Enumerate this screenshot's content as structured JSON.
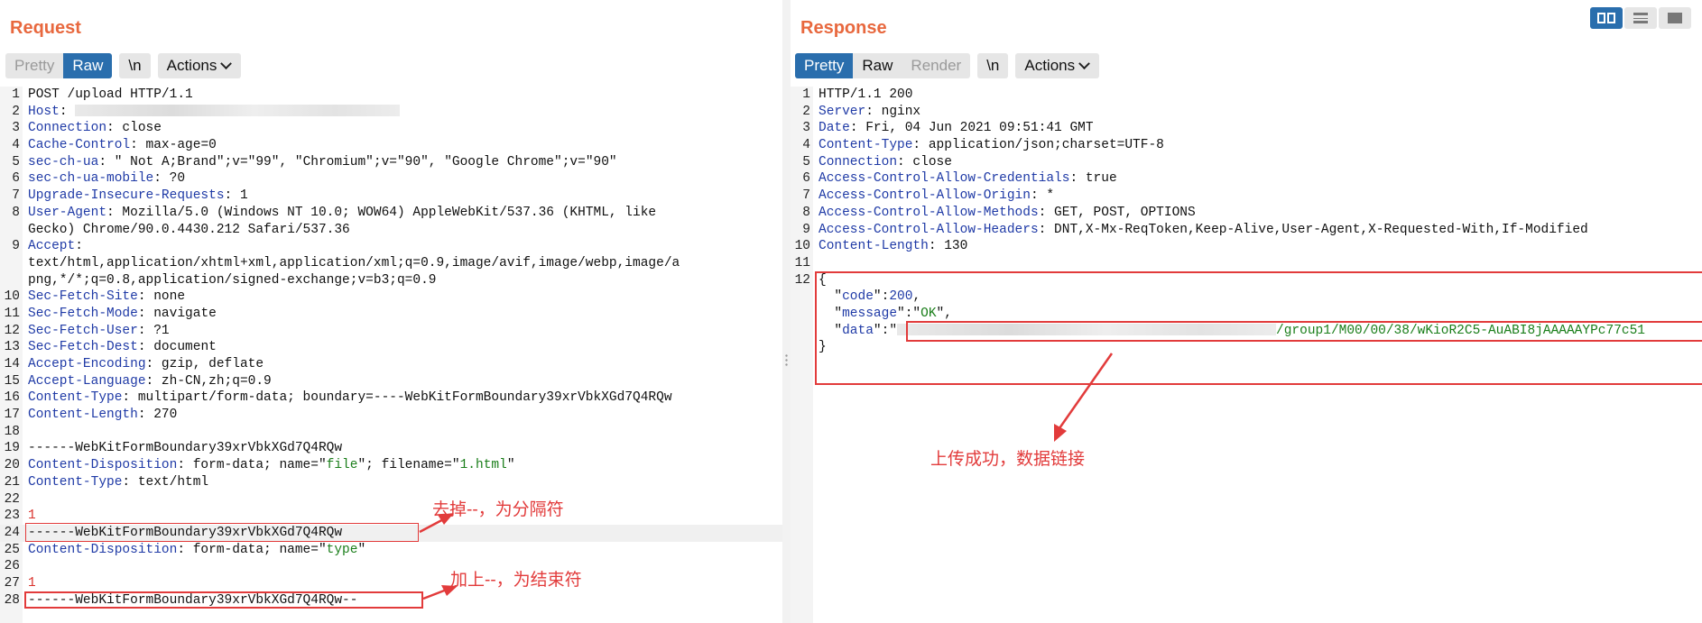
{
  "request": {
    "title": "Request",
    "buttons": {
      "pretty": "Pretty",
      "raw": "Raw",
      "newline": "\\n",
      "actions": "Actions"
    },
    "lines": [
      {
        "n": "1",
        "parts": [
          [
            "",
            "POST /upload HTTP/1.1"
          ]
        ]
      },
      {
        "n": "2",
        "parts": [
          [
            "k",
            "Host"
          ],
          [
            "",
            ": "
          ],
          [
            "redact",
            "360"
          ]
        ]
      },
      {
        "n": "3",
        "parts": [
          [
            "k",
            "Connection"
          ],
          [
            "",
            ": close"
          ]
        ]
      },
      {
        "n": "4",
        "parts": [
          [
            "k",
            "Cache-Control"
          ],
          [
            "",
            ": max-age=0"
          ]
        ]
      },
      {
        "n": "5",
        "parts": [
          [
            "k",
            "sec-ch-ua"
          ],
          [
            "",
            ": \" Not A;Brand\";v=\"99\", \"Chromium\";v=\"90\", \"Google Chrome\";v=\"90\""
          ]
        ]
      },
      {
        "n": "6",
        "parts": [
          [
            "k",
            "sec-ch-ua-mobile"
          ],
          [
            "",
            ": ?0"
          ]
        ]
      },
      {
        "n": "7",
        "parts": [
          [
            "k",
            "Upgrade-Insecure-Requests"
          ],
          [
            "",
            ": 1"
          ]
        ]
      },
      {
        "n": "8",
        "parts": [
          [
            "k",
            "User-Agent"
          ],
          [
            "",
            ": Mozilla/5.0 (Windows NT 10.0; WOW64) AppleWebKit/537.36 (KHTML, like"
          ]
        ]
      },
      {
        "n": "",
        "parts": [
          [
            "",
            "Gecko) Chrome/90.0.4430.212 Safari/537.36"
          ]
        ]
      },
      {
        "n": "9",
        "parts": [
          [
            "k",
            "Accept"
          ],
          [
            "",
            ":"
          ]
        ]
      },
      {
        "n": "",
        "parts": [
          [
            "",
            "text/html,application/xhtml+xml,application/xml;q=0.9,image/avif,image/webp,image/a"
          ]
        ]
      },
      {
        "n": "",
        "parts": [
          [
            "",
            "png,*/*;q=0.8,application/signed-exchange;v=b3;q=0.9"
          ]
        ]
      },
      {
        "n": "10",
        "parts": [
          [
            "k",
            "Sec-Fetch-Site"
          ],
          [
            "",
            ": none"
          ]
        ]
      },
      {
        "n": "11",
        "parts": [
          [
            "k",
            "Sec-Fetch-Mode"
          ],
          [
            "",
            ": navigate"
          ]
        ]
      },
      {
        "n": "12",
        "parts": [
          [
            "k",
            "Sec-Fetch-User"
          ],
          [
            "",
            ": ?1"
          ]
        ]
      },
      {
        "n": "13",
        "parts": [
          [
            "k",
            "Sec-Fetch-Dest"
          ],
          [
            "",
            ": document"
          ]
        ]
      },
      {
        "n": "14",
        "parts": [
          [
            "k",
            "Accept-Encoding"
          ],
          [
            "",
            ": gzip, deflate"
          ]
        ]
      },
      {
        "n": "15",
        "parts": [
          [
            "k",
            "Accept-Language"
          ],
          [
            "",
            ": zh-CN,zh;q=0.9"
          ]
        ]
      },
      {
        "n": "16",
        "parts": [
          [
            "k",
            "Content-Type"
          ],
          [
            "",
            ": multipart/form-data; boundary=----WebKitFormBoundary39xrVbkXGd7Q4RQw"
          ]
        ]
      },
      {
        "n": "17",
        "parts": [
          [
            "k",
            "Content-Length"
          ],
          [
            "",
            ": 270"
          ]
        ]
      },
      {
        "n": "18",
        "parts": []
      },
      {
        "n": "19",
        "parts": [
          [
            "",
            "------WebKitFormBoundary39xrVbkXGd7Q4RQw"
          ]
        ]
      },
      {
        "n": "20",
        "parts": [
          [
            "k",
            "Content-Disposition"
          ],
          [
            "",
            ": form-data; name=\""
          ],
          [
            "s",
            "file"
          ],
          [
            "",
            "\"; filename=\""
          ],
          [
            "s",
            "1.html"
          ],
          [
            "",
            "\""
          ]
        ]
      },
      {
        "n": "21",
        "parts": [
          [
            "k",
            "Content-Type"
          ],
          [
            "",
            ": text/html"
          ]
        ]
      },
      {
        "n": "22",
        "parts": []
      },
      {
        "n": "23",
        "parts": [
          [
            "red",
            "1"
          ]
        ]
      },
      {
        "n": "24",
        "parts": [
          [
            "",
            "------WebKitFormBoundary39xrVbkXGd7Q4RQw"
          ]
        ],
        "hl": true
      },
      {
        "n": "25",
        "parts": [
          [
            "k",
            "Content-Disposition"
          ],
          [
            "",
            ": form-data; name=\""
          ],
          [
            "s",
            "type"
          ],
          [
            "",
            "\""
          ]
        ]
      },
      {
        "n": "26",
        "parts": []
      },
      {
        "n": "27",
        "parts": [
          [
            "red",
            "1"
          ]
        ]
      },
      {
        "n": "28",
        "parts": [
          [
            "",
            "------WebKitFormBoundary39xrVbkXGd7Q4RQw--"
          ]
        ]
      }
    ]
  },
  "response": {
    "title": "Response",
    "buttons": {
      "pretty": "Pretty",
      "raw": "Raw",
      "render": "Render",
      "newline": "\\n",
      "actions": "Actions"
    },
    "lines": [
      {
        "n": "1",
        "parts": [
          [
            "",
            "HTTP/1.1 200"
          ]
        ]
      },
      {
        "n": "2",
        "parts": [
          [
            "k",
            "Server"
          ],
          [
            "",
            ": nginx"
          ]
        ]
      },
      {
        "n": "3",
        "parts": [
          [
            "k",
            "Date"
          ],
          [
            "",
            ": Fri, 04 Jun 2021 09:51:41 GMT"
          ]
        ]
      },
      {
        "n": "4",
        "parts": [
          [
            "k",
            "Content-Type"
          ],
          [
            "",
            ": application/json;charset=UTF-8"
          ]
        ]
      },
      {
        "n": "5",
        "parts": [
          [
            "k",
            "Connection"
          ],
          [
            "",
            ": close"
          ]
        ]
      },
      {
        "n": "6",
        "parts": [
          [
            "k",
            "Access-Control-Allow-Credentials"
          ],
          [
            "",
            ": true"
          ]
        ]
      },
      {
        "n": "7",
        "parts": [
          [
            "k",
            "Access-Control-Allow-Origin"
          ],
          [
            "",
            ": *"
          ]
        ]
      },
      {
        "n": "8",
        "parts": [
          [
            "k",
            "Access-Control-Allow-Methods"
          ],
          [
            "",
            ": GET, POST, OPTIONS"
          ]
        ]
      },
      {
        "n": "9",
        "parts": [
          [
            "k",
            "Access-Control-Allow-Headers"
          ],
          [
            "",
            ": DNT,X-Mx-ReqToken,Keep-Alive,User-Agent,X-Requested-With,If-Modified"
          ]
        ]
      },
      {
        "n": "10",
        "parts": [
          [
            "k",
            "Content-Length"
          ],
          [
            "",
            ": 130"
          ]
        ]
      },
      {
        "n": "11",
        "parts": []
      },
      {
        "n": "12",
        "parts": [
          [
            "",
            "{"
          ]
        ]
      },
      {
        "n": "",
        "parts": [
          [
            "",
            "  \""
          ],
          [
            "k",
            "code"
          ],
          [
            "",
            "\":"
          ],
          [
            "n",
            "200"
          ],
          [
            "",
            ","
          ]
        ]
      },
      {
        "n": "",
        "parts": [
          [
            "",
            "  \""
          ],
          [
            "k",
            "message"
          ],
          [
            "",
            "\":\""
          ],
          [
            "s",
            "OK"
          ],
          [
            "",
            "\","
          ]
        ]
      },
      {
        "n": "",
        "parts": [
          [
            "",
            "  \""
          ],
          [
            "k",
            "data"
          ],
          [
            "",
            "\":\""
          ],
          [
            "redact",
            "420"
          ],
          [
            "s",
            "/group1/M00/00/38/wKioR2C5-AuABI8jAAAAAYPc77c51"
          ]
        ]
      },
      {
        "n": "",
        "parts": [
          [
            "",
            "}"
          ]
        ]
      }
    ]
  },
  "annotations": {
    "remove_note": "去掉--，为分隔符",
    "add_note": "加上--，为结束符",
    "success_note": "上传成功，数据链接"
  },
  "view_toggles": [
    "split-horizontal-icon",
    "split-vertical-icon",
    "single-pane-icon"
  ],
  "colors": {
    "accent": "#2a6ead",
    "title": "#e8683e",
    "annotation": "#e23b3b",
    "header_key": "#1f3aa6",
    "string": "#1a7e1a"
  }
}
